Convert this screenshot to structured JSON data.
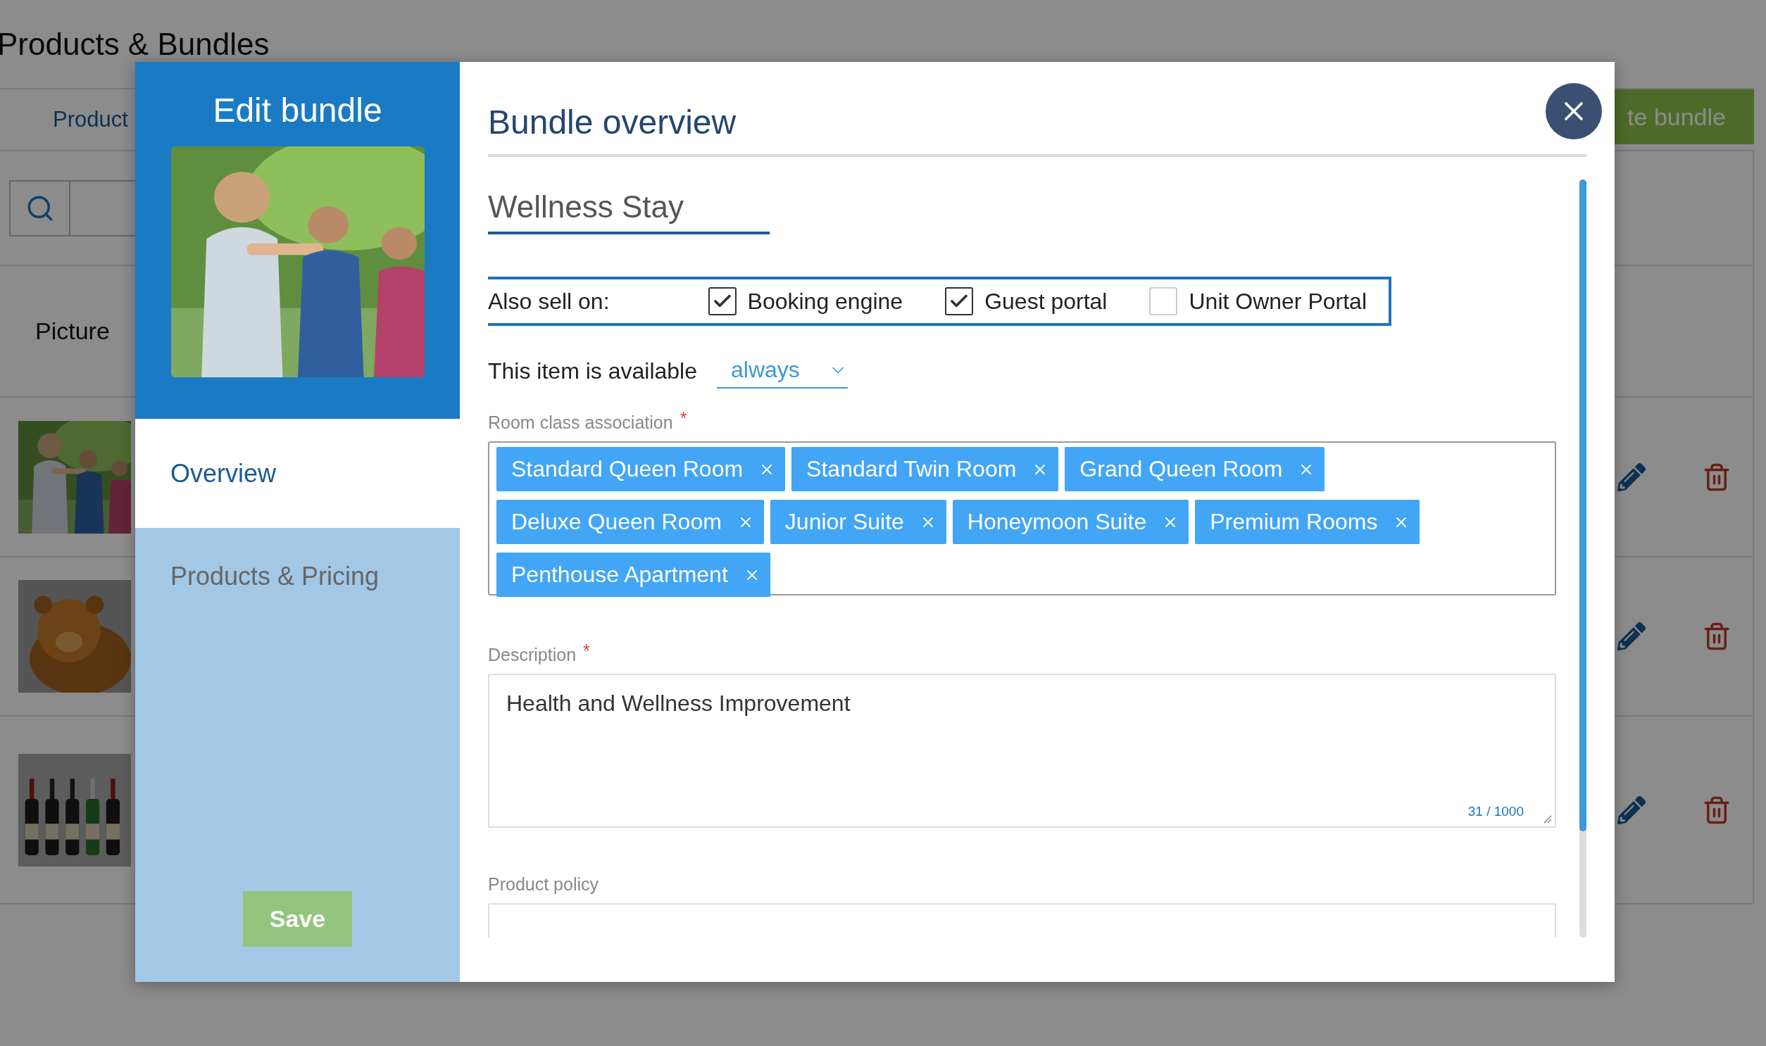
{
  "page": {
    "title": "Products & Bundles",
    "tab": "Product",
    "create_button": "te bundle",
    "column_header": "Picture",
    "rows": [
      {
        "kind": "people"
      },
      {
        "kind": "dog"
      },
      {
        "kind": "bottles"
      }
    ]
  },
  "modal": {
    "title": "Edit bundle",
    "nav": [
      {
        "label": "Overview",
        "selected": true
      },
      {
        "label": "Products & Pricing",
        "selected": false
      }
    ],
    "save_button": "Save",
    "heading": "Bundle overview",
    "name": "Wellness Stay",
    "sell_on": {
      "label": "Also sell on:",
      "options": [
        {
          "label": "Booking engine",
          "checked": true
        },
        {
          "label": "Guest portal",
          "checked": true
        },
        {
          "label": "Unit Owner Portal",
          "checked": false
        }
      ]
    },
    "availability": {
      "label": "This item is available",
      "value": "always"
    },
    "room_classes": {
      "label": "Room class association",
      "required_mark": "*",
      "tags": [
        "Standard Queen Room",
        "Standard Twin Room",
        "Grand Queen Room",
        "Deluxe Queen Room",
        "Junior Suite",
        "Honeymoon Suite",
        "Premium Rooms",
        "Penthouse Apartment"
      ]
    },
    "description": {
      "label": "Description",
      "required_mark": "*",
      "value": "Health and Wellness Improvement",
      "counter": "31 / 1000"
    },
    "policy": {
      "label": "Product policy"
    }
  }
}
